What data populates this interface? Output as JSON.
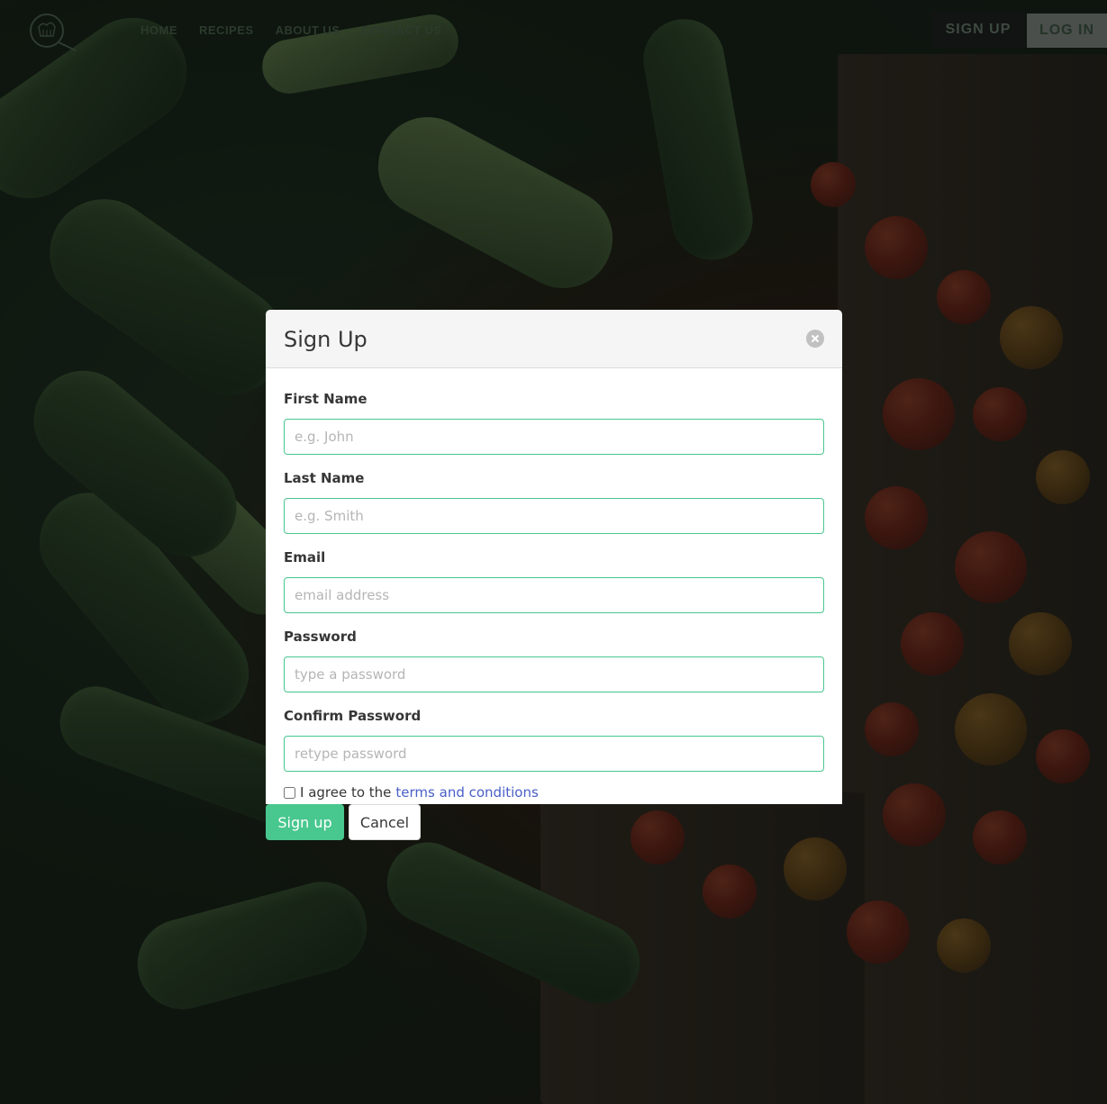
{
  "nav": {
    "links": [
      "HOME",
      "RECIPES",
      "ABOUT US",
      "CONTACT US"
    ],
    "signup_label": "SIGN UP",
    "login_label": "LOG IN"
  },
  "modal": {
    "title": "Sign Up",
    "fields": {
      "first_name": {
        "label": "First Name",
        "placeholder": "e.g. John"
      },
      "last_name": {
        "label": "Last Name",
        "placeholder": "e.g. Smith"
      },
      "email": {
        "label": "Email",
        "placeholder": "email address"
      },
      "password": {
        "label": "Password",
        "placeholder": "type a password"
      },
      "confirm_password": {
        "label": "Confirm Password",
        "placeholder": "retype password"
      }
    },
    "agree_text": "I agree to the",
    "terms_link": "terms and conditions",
    "submit_label": "Sign up",
    "cancel_label": "Cancel"
  },
  "colors": {
    "accent": "#48c78e",
    "link": "#485fc7"
  }
}
